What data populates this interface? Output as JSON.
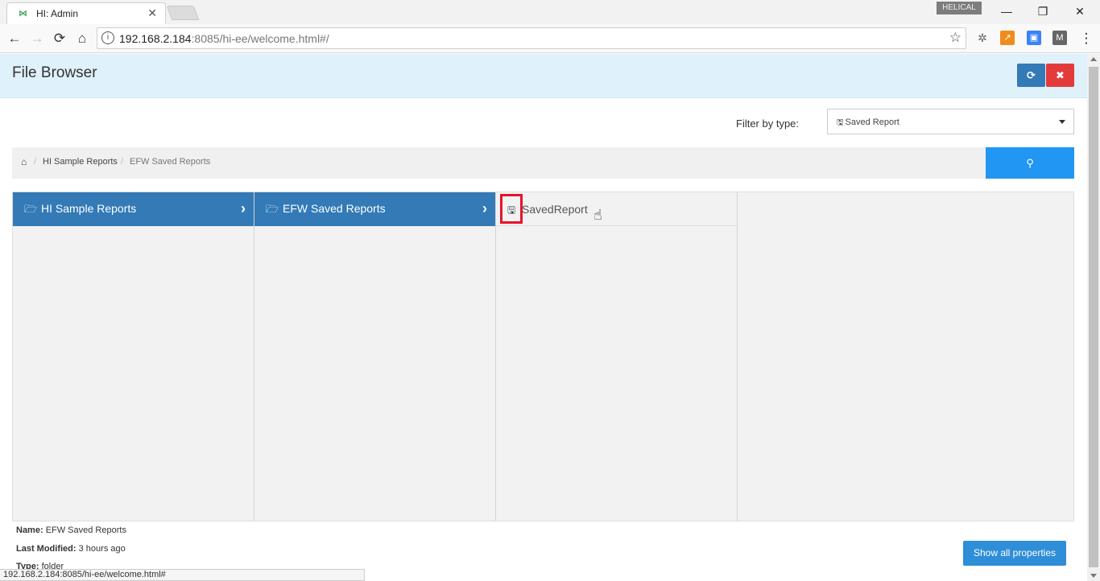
{
  "browser": {
    "tab_title": "HI: Admin",
    "tab_close": "✕",
    "profile_name": "HELICAL",
    "url_host": "192.168.2.184",
    "url_rest": ":8085/hi-ee/welcome.html#/",
    "status_url": "192.168.2.184:8085/hi-ee/welcome.html#",
    "icons": {
      "back": "←",
      "forward": "→",
      "reload": "⟳",
      "home": "⌂",
      "info": "i",
      "star": "☆",
      "minimize": "—",
      "restore": "❐",
      "close": "✕",
      "menu": "⋮"
    }
  },
  "app": {
    "title": "File Browser",
    "refresh_icon": "⟳",
    "close_icon": "✖",
    "filter_label": "Filter by type:",
    "filter_value": "Saved Report",
    "search_icon": "⚲",
    "breadcrumb": {
      "home_icon": "⌂",
      "separator": "/",
      "items": [
        "HI Sample Reports",
        "EFW Saved Reports"
      ]
    },
    "columns": [
      {
        "name": "HI Sample Reports",
        "type": "folder",
        "selected": true
      },
      {
        "name": "EFW Saved Reports",
        "type": "folder",
        "selected": true
      },
      {
        "name": "SavedReport",
        "type": "file",
        "highlighted": true
      }
    ],
    "properties": {
      "name_label": "Name:",
      "name_value": "EFW Saved Reports",
      "modified_label": "Last Modified:",
      "modified_value": "3 hours ago",
      "type_label": "Type:",
      "type_value": "folder"
    },
    "show_all_label": "Show all properties"
  },
  "colors": {
    "header_bg": "#dff1fa",
    "primary": "#337ab7",
    "danger": "#e33b3b",
    "search": "#2196f3",
    "highlight": "#e8132a"
  }
}
